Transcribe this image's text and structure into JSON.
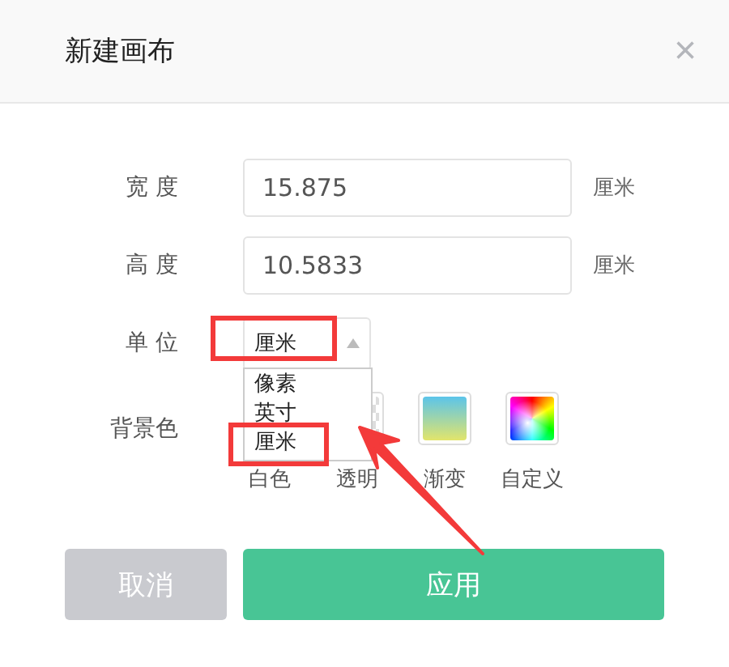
{
  "dialog": {
    "title": "新建画布",
    "close": "×"
  },
  "fields": [
    {
      "label": "宽 度",
      "value": "15.875",
      "unit": "厘米"
    },
    {
      "label": "高 度",
      "value": "10.5833",
      "unit": "厘米"
    }
  ],
  "unit_select": {
    "label": "单 位",
    "value": "厘米",
    "options": [
      "像素",
      "英寸",
      "厘米"
    ]
  },
  "background": {
    "label": "背景色",
    "swatches": [
      {
        "kind": "white",
        "label": "白色"
      },
      {
        "kind": "transparent",
        "label": "透明"
      },
      {
        "kind": "gradient",
        "label": "渐变"
      },
      {
        "kind": "custom",
        "label": "自定义"
      }
    ]
  },
  "buttons": [
    {
      "kind": "cancel",
      "label": "取消"
    },
    {
      "kind": "apply",
      "label": "应用"
    }
  ]
}
